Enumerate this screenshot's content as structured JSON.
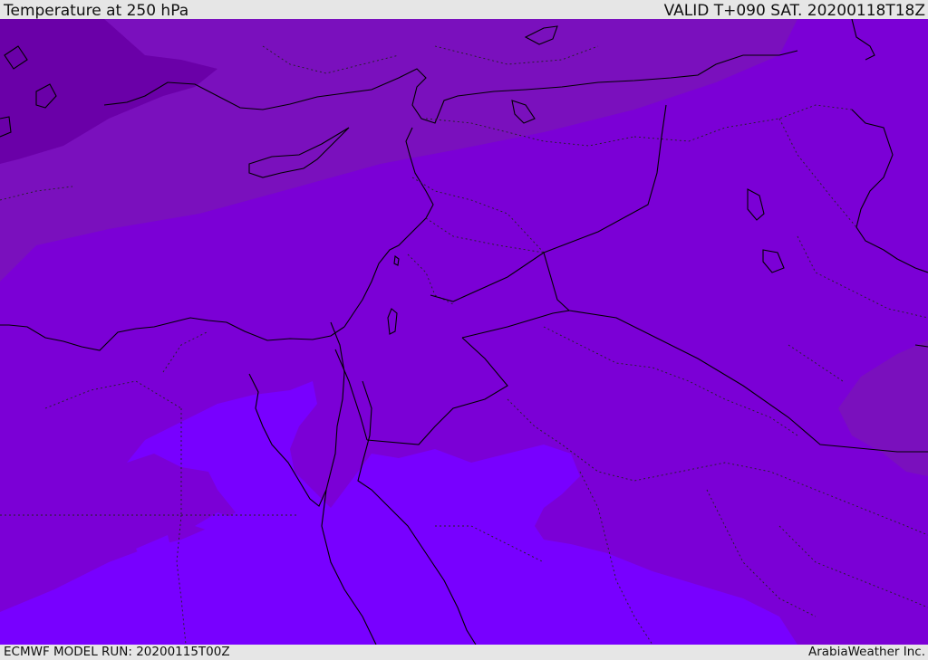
{
  "header": {
    "title": "Temperature at 250 hPa",
    "valid_time": "VALID T+090 SAT. 20200118T18Z"
  },
  "footer": {
    "model_run": "ECMWF MODEL RUN: 20200115T00Z",
    "provider": "ArabiaWeather Inc."
  },
  "map": {
    "parameter": "temperature",
    "pressure_level_hPa": 250,
    "colors": {
      "coldest_band": "#6a00a8",
      "cold_band": "#7a10bd",
      "main_band": "#7b00d6",
      "warm_band": "#7800ff",
      "borders": "#000000"
    }
  }
}
